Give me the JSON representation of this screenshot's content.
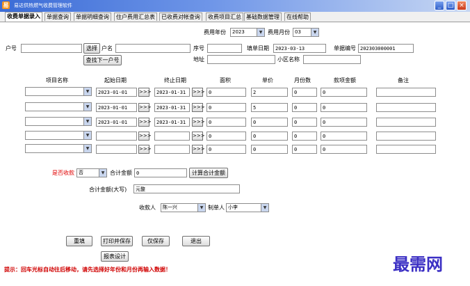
{
  "window": {
    "title": "易达供热燃气收费管理软件",
    "minimize": "_",
    "maximize": "□",
    "close": "×"
  },
  "tabs": [
    "收费单据录入",
    "单据查询",
    "单据明细查询",
    "住户费用汇总表",
    "已收费对帐查询",
    "收费项目汇总",
    "基础数据管理",
    "在线帮助"
  ],
  "period": {
    "year_label": "费用年份",
    "year": "2023",
    "month_label": "费用月份",
    "month": "03"
  },
  "header": {
    "household_label": "户号",
    "household_value": "",
    "select_button": "选择",
    "name_label": "户名",
    "name_value": "",
    "find_next_button": "查找下一户号",
    "building_label": "序号",
    "building_value": "",
    "date_label": "填单日期",
    "date_value": "2023-03-13",
    "receipt_label": "单据编号",
    "receipt_value": "202303000001",
    "address_label": "地址",
    "address_value": "",
    "community_label": "小区名称",
    "community_value": ""
  },
  "columns": {
    "item": "项目名称",
    "start": "起始日期",
    "end": "终止日期",
    "area": "面积",
    "price": "单价",
    "months": "月份数",
    "amount": "款项金额",
    "note": "备注"
  },
  "arrow_label": ">>>",
  "rows": [
    {
      "item": "",
      "start": "2023-01-01",
      "end": "2023-01-31",
      "area": "0",
      "price": "2",
      "months": "0",
      "amount": "0",
      "note": ""
    },
    {
      "item": "",
      "start": "2023-01-01",
      "end": "2023-01-31",
      "area": "0",
      "price": "5",
      "months": "0",
      "amount": "0",
      "note": ""
    },
    {
      "item": "",
      "start": "2023-01-01",
      "end": "2023-01-31",
      "area": "0",
      "price": "0",
      "months": "0",
      "amount": "0",
      "note": ""
    },
    {
      "item": "",
      "start": "",
      "end": "",
      "area": "0",
      "price": "0",
      "months": "0",
      "amount": "0",
      "note": ""
    },
    {
      "item": "",
      "start": "",
      "end": "",
      "area": "0",
      "price": "0",
      "months": "0",
      "amount": "0",
      "note": ""
    }
  ],
  "payment": {
    "paid_label": "是否收款",
    "paid_value": "否",
    "total_label": "合计金额",
    "total_value": "0",
    "calc_button": "计算合计金额",
    "upper_label": "合计金额(大写)",
    "upper_value": "元整",
    "payee_label": "收款人",
    "payee_value": "陈一兴",
    "maker_label": "制单人",
    "maker_value": "小李"
  },
  "actions": {
    "clear": "重填",
    "print_save": "打印并保存",
    "save_only": "仅保存",
    "exit": "退出",
    "report_design": "报表设计"
  },
  "hint": "提示：回车光标自动往后移动，请先选择好年份和月份再输入数据！",
  "watermark": "最需网",
  "colors": {
    "titlebar": "#3b6cd6",
    "hint": "#d00000",
    "paid_label": "#e00000",
    "watermark": "#3b2fc4"
  }
}
